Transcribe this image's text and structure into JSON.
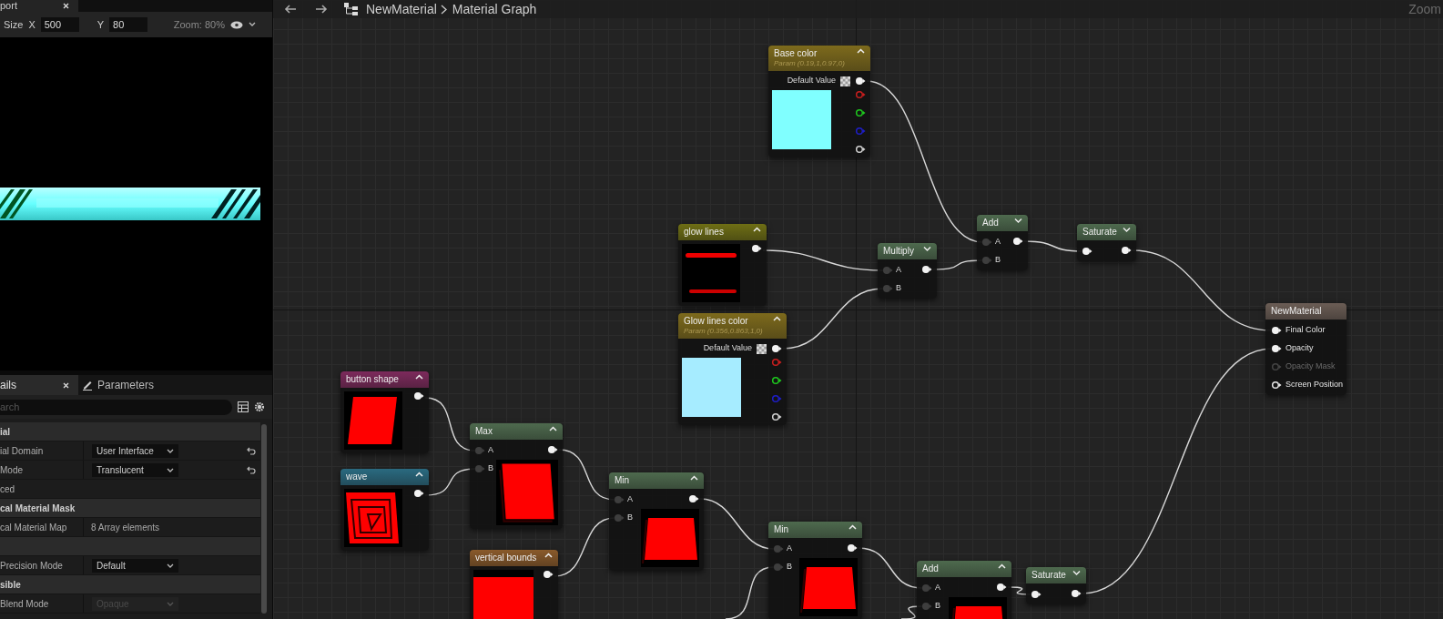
{
  "viewport": {
    "tab": "port",
    "size_label": "Size",
    "x_label": "X",
    "x_value": "500",
    "y_label": "Y",
    "y_value": "80",
    "zoom": "Zoom: 80%"
  },
  "details": {
    "tabs": [
      {
        "label": "ails",
        "selected": true
      },
      {
        "label": "Parameters",
        "selected": false
      }
    ],
    "search": {
      "placeholder": "arch"
    },
    "rows": [
      {
        "kind": "section",
        "label": "ial"
      },
      {
        "kind": "dropdown",
        "label": "ial Domain",
        "value": "User Interface",
        "reset": true,
        "disabled": false
      },
      {
        "kind": "dropdown",
        "label": "Mode",
        "value": "Translucent",
        "reset": true,
        "disabled": false
      },
      {
        "kind": "category",
        "label": "ced"
      },
      {
        "kind": "section",
        "label": "cal Material Mask"
      },
      {
        "kind": "text",
        "label": "cal Material Map",
        "value": "8 Array elements",
        "reset": false,
        "disabled": false
      },
      {
        "kind": "section"
      },
      {
        "kind": "dropdown",
        "label": "Precision Mode",
        "value": "Default",
        "reset": false,
        "disabled": false
      },
      {
        "kind": "section",
        "label": "sible"
      },
      {
        "kind": "dropdown",
        "label": "Blend Mode",
        "value": "Opaque",
        "reset": false,
        "disabled": true
      }
    ]
  },
  "toolbar": {
    "breadcrumb": [
      "NewMaterial",
      "Material Graph"
    ],
    "zoom_label": "Zoom"
  },
  "graph": {
    "nodes": [
      {
        "kind": "texture",
        "title": "button shape",
        "color": "#7d2a5c",
        "expanded": true
      },
      {
        "kind": "texture",
        "title": "wave",
        "color": "#2a6a80",
        "expanded": true
      },
      {
        "kind": "math",
        "title": "Max",
        "color": "#4e6a4e",
        "expanded": true,
        "preview": true,
        "inputs": [
          {
            "label": "A",
            "filled": false
          },
          {
            "label": "B",
            "filled": false
          }
        ]
      },
      {
        "kind": "texture",
        "title": "vertical bounds",
        "color": "#8a5a2a",
        "expanded": true
      },
      {
        "kind": "math",
        "title": "Min",
        "color": "#4e6a4e",
        "expanded": true,
        "preview": true,
        "inputs": [
          {
            "label": "A",
            "filled": false
          },
          {
            "label": "B",
            "filled": false
          }
        ]
      },
      {
        "kind": "texture",
        "title": "glow lines",
        "color": "#6e6e14",
        "expanded": true
      },
      {
        "kind": "param",
        "title": "Glow lines color",
        "subtitle": "Param (0.356,0.863,1,0)",
        "color": "#7d6a1c",
        "expanded": true,
        "value_label": "Default Value",
        "swatch": {
          "color": "#a6ecff"
        },
        "channels": [
          {
            "color": "#c81e1e"
          },
          {
            "color": "#1ec81e"
          },
          {
            "color": "#1e1ec8"
          },
          {
            "color": "#d0d0d0"
          }
        ]
      },
      {
        "kind": "param",
        "title": "Base color",
        "subtitle": "Param (0.19,1,0.97,0)",
        "color": "#7d6a1c",
        "expanded": true,
        "value_label": "Default Value",
        "swatch": {
          "color": "#80ffff"
        },
        "channels": [
          {
            "color": "#c81e1e"
          },
          {
            "color": "#1ec81e"
          },
          {
            "color": "#1e1ec8"
          },
          {
            "color": "#d0d0d0"
          }
        ]
      },
      {
        "kind": "math",
        "title": "Min",
        "color": "#4e6a4e",
        "expanded": true,
        "preview": true,
        "inputs": [
          {
            "label": "A",
            "filled": false
          },
          {
            "label": "B",
            "filled": false
          }
        ]
      },
      {
        "kind": "math",
        "title": "Multiply",
        "color": "#4e6a4e",
        "expanded": false,
        "preview": false,
        "inputs": [
          {
            "label": "A",
            "filled": false
          },
          {
            "label": "B",
            "filled": false
          }
        ]
      },
      {
        "kind": "math",
        "title": "Add",
        "color": "#4e6a4e",
        "expanded": true,
        "preview": true,
        "inputs": [
          {
            "label": "A",
            "filled": false
          },
          {
            "label": "B",
            "filled": false
          }
        ]
      },
      {
        "kind": "math",
        "title": "Add",
        "color": "#4e6a4e",
        "expanded": false,
        "preview": false,
        "inputs": [
          {
            "label": "A",
            "filled": false
          },
          {
            "label": "B",
            "filled": false
          }
        ]
      },
      {
        "kind": "math",
        "title": "Saturate",
        "color": "#4e6a4e",
        "expanded": false,
        "preview": false,
        "inputs": [
          {
            "filled": true
          }
        ]
      },
      {
        "kind": "math",
        "title": "Saturate",
        "color": "#4e6a4e",
        "expanded": false,
        "preview": false,
        "inputs": [
          {
            "filled": true
          }
        ]
      },
      {
        "kind": "output",
        "title": "NewMaterial",
        "color": "#6b5d55",
        "inputs": [
          {
            "label": "Final Color",
            "connected": true,
            "disabled": false
          },
          {
            "label": "Opacity",
            "connected": true,
            "disabled": false
          },
          {
            "label": "Opacity Mask",
            "connected": false,
            "disabled": true
          },
          {
            "label": "Screen Position",
            "connected": false,
            "disabled": false
          }
        ]
      }
    ]
  }
}
